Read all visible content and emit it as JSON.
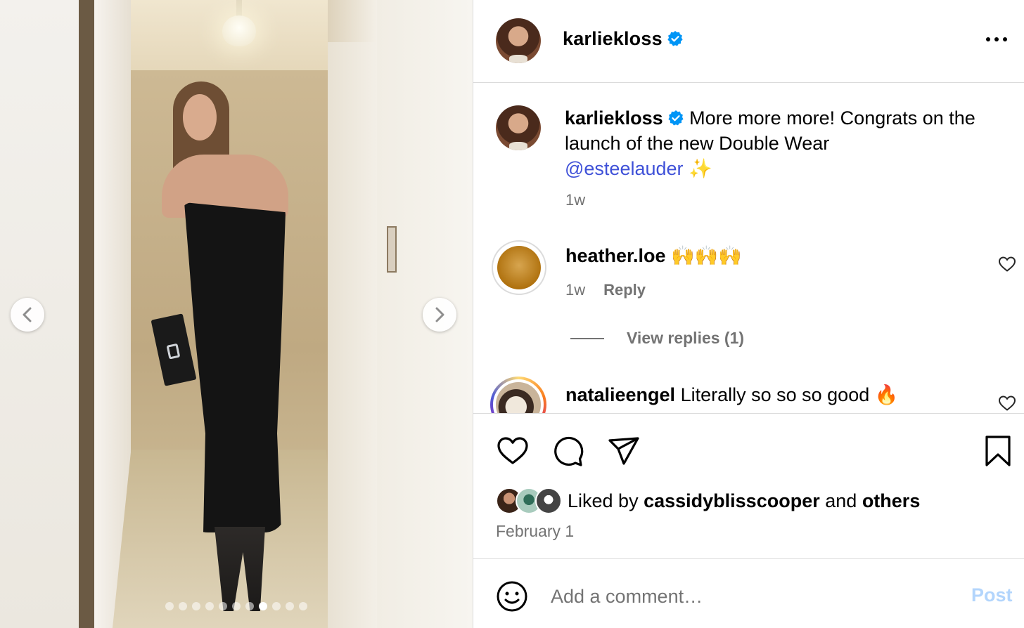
{
  "carousel": {
    "prev_icon": "chevron-left-icon",
    "next_icon": "chevron-right-icon",
    "slide_count": 11,
    "active_slide": 8
  },
  "post_header": {
    "username": "karliekloss",
    "verified_icon": "verified-badge-icon",
    "more_icon": "more-horizontal-icon"
  },
  "caption": {
    "username": "karliekloss",
    "text": "More more more! Congrats on the launch of the new Double Wear",
    "mention": "@esteelauder",
    "emoji": "✨",
    "time": "1w"
  },
  "comments": [
    {
      "username": "heather.loe",
      "text": "🙌🙌🙌",
      "time": "1w",
      "reply_label": "Reply",
      "view_replies_label": "View replies (1)"
    },
    {
      "username": "natalieengel",
      "text": "Literally so so so good 🔥"
    }
  ],
  "actions": {
    "like_icon": "heart-icon",
    "comment_icon": "comment-icon",
    "share_icon": "send-icon",
    "save_icon": "bookmark-icon"
  },
  "likes": {
    "prefix": "Liked by",
    "user": "cassidyblisscooper",
    "conjunction": "and",
    "others": "others"
  },
  "post_date": "February 1",
  "add_comment": {
    "emoji_icon": "emoji-icon",
    "placeholder": "Add a comment…",
    "post_label": "Post"
  },
  "colors": {
    "mention": "#3f51d8",
    "verified": "#0095f6",
    "secondary_text": "#737373",
    "post_disabled": "#b3d5fc"
  }
}
